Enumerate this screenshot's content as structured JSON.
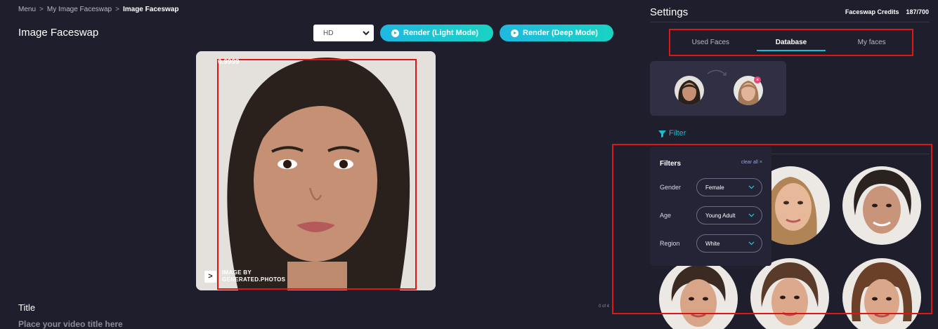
{
  "breadcrumb": {
    "items": [
      "Menu",
      "My Image Faceswap",
      "Image Faceswap"
    ],
    "separator": ">"
  },
  "page": {
    "title": "Image Faceswap"
  },
  "toolbar": {
    "quality": {
      "selected": "HD"
    },
    "render_light": "Render (Light Mode)",
    "render_deep": "Render (Deep Mode)"
  },
  "preview": {
    "score": "0.9999",
    "watermark": {
      "line1": "IMAGE BY",
      "line2": "GENERATED.PHOTOS",
      "mark": ">"
    }
  },
  "title_field": {
    "label": "Title",
    "placeholder": "Place your video title here",
    "counter": "0 of 4"
  },
  "settings": {
    "title": "Settings",
    "credits_label": "Faceswap Credits",
    "credits_value": "187/700",
    "tabs": [
      {
        "label": "Used Faces",
        "active": false
      },
      {
        "label": "Database",
        "active": true
      },
      {
        "label": "My faces",
        "active": false
      }
    ]
  },
  "filter": {
    "toggle_label": "Filter",
    "panel_title": "Filters",
    "clear_all": "clear all ×",
    "rows": [
      {
        "label": "Gender",
        "value": "Female"
      },
      {
        "label": "Age",
        "value": "Young Adult"
      },
      {
        "label": "Region",
        "value": "White"
      }
    ]
  },
  "colors": {
    "accent": "#19bcd0",
    "highlight": "#e01515",
    "background": "#1f1e2c"
  }
}
